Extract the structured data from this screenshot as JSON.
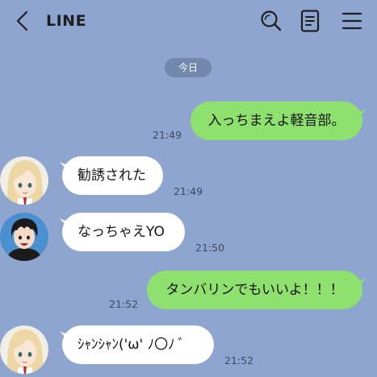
{
  "header": {
    "title": "LINE",
    "icons": [
      "back-chevron-icon",
      "search-icon",
      "notes-icon",
      "menu-icon"
    ]
  },
  "date_divider": "今日",
  "messages": [
    {
      "direction": "outgoing",
      "text": "入っちまえよ軽音部。",
      "time": "21:49"
    },
    {
      "direction": "incoming",
      "sender_avatar": "blonde-girl-avatar",
      "text": "勧誘された",
      "time": "21:49"
    },
    {
      "direction": "incoming",
      "sender_avatar": "dark-haired-boy-avatar",
      "text": "なっちゃえYO",
      "time": "21:50"
    },
    {
      "direction": "outgoing",
      "text": "タンバリンでもいいよ！！！",
      "time": "21:52"
    },
    {
      "direction": "incoming",
      "sender_avatar": "blonde-girl-avatar",
      "text": "ｼｬﾝｼｬﾝ('ω' ﾉ〇ﾉ ﾞ",
      "time": "21:52"
    }
  ],
  "colors": {
    "background": "#8ea5cf",
    "outgoing_bubble": "#8ee06f",
    "incoming_bubble": "#ffffff",
    "date_pill": "#7288ad"
  }
}
